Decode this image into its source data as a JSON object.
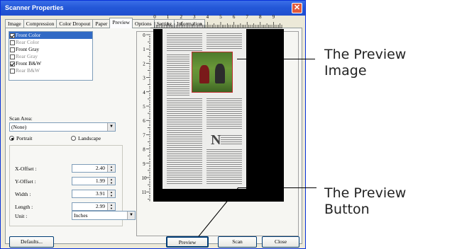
{
  "window": {
    "title": "Scanner Properties",
    "close_symbol": "✕"
  },
  "tabs": [
    {
      "label": "Image",
      "active": false
    },
    {
      "label": "Compression",
      "active": false
    },
    {
      "label": "Color Dropout",
      "active": false
    },
    {
      "label": "Paper",
      "active": false
    },
    {
      "label": "Preview",
      "active": true
    },
    {
      "label": "Options",
      "active": false
    },
    {
      "label": "Setting",
      "active": false
    },
    {
      "label": "Information",
      "active": false
    }
  ],
  "image_list": [
    {
      "label": "Front Color",
      "checked": true,
      "selected": true
    },
    {
      "label": "Rear Color",
      "checked": false,
      "dimmed": true
    },
    {
      "label": "Front Gray",
      "checked": false
    },
    {
      "label": "Rear Gray",
      "checked": false,
      "dimmed": true
    },
    {
      "label": "Front B&W",
      "checked": true
    },
    {
      "label": "Rear B&W",
      "checked": false,
      "dimmed": true
    }
  ],
  "scan_area": {
    "label": "Scan Area:",
    "value": "(None)"
  },
  "orientation": {
    "portrait": "Portrait",
    "landscape": "Landscape",
    "selected": "Portrait"
  },
  "fields": {
    "x_offset": {
      "label": "X-Offset :",
      "value": "2.40"
    },
    "y_offset": {
      "label": "Y-Offset :",
      "value": "1.99"
    },
    "width": {
      "label": "Width :",
      "value": "3.91"
    },
    "length": {
      "label": "Length :",
      "value": "2.99"
    },
    "unit": {
      "label": "Unit :",
      "value": "Inches"
    }
  },
  "ruler": {
    "top": [
      "0",
      "1",
      "2",
      "3",
      "4",
      "5",
      "6",
      "7",
      "8",
      "9"
    ],
    "left": [
      "0",
      "1",
      "2",
      "3",
      "4",
      "5",
      "6",
      "7",
      "8",
      "9",
      "10",
      "11"
    ]
  },
  "buttons": {
    "defaults": "Defaults...",
    "preview": "Preview",
    "scan": "Scan",
    "close": "Close"
  },
  "callouts": {
    "preview_image_line1": "The Preview",
    "preview_image_line2": "Image",
    "preview_button_line1": "The Preview",
    "preview_button_line2": "Button"
  },
  "colors": {
    "titlebar": "#2458d8",
    "selection": "#316ac5",
    "close_button": "#e25a3b"
  }
}
